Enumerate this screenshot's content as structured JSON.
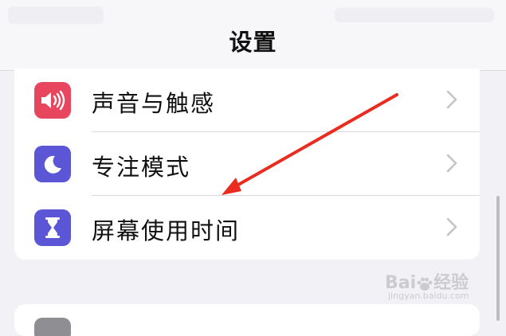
{
  "nav": {
    "title": "设置"
  },
  "settings": {
    "items": [
      {
        "label": "声音与触感",
        "icon": "speaker-icon",
        "color": "#e8455f"
      },
      {
        "label": "专注模式",
        "icon": "moon-icon",
        "color": "#5b56d6"
      },
      {
        "label": "屏幕使用时间",
        "icon": "hourglass-icon",
        "color": "#5b56d6"
      }
    ]
  },
  "watermark": {
    "brand": "Bai",
    "brand_end": "经验",
    "url": "jingyan.baidu.com"
  }
}
